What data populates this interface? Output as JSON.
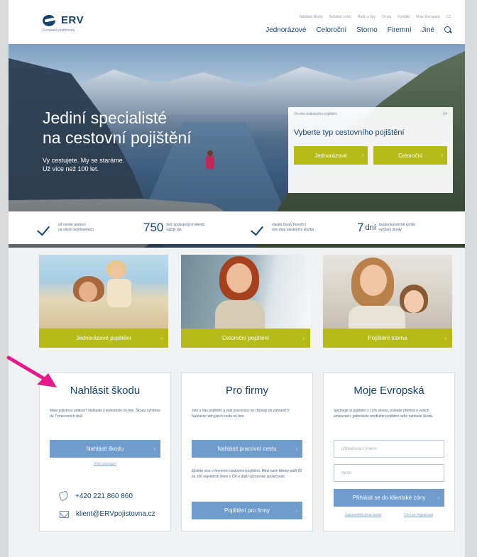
{
  "header": {
    "logo_text": "ERV",
    "logo_sub": "Evropská pojišťovna",
    "top_links": [
      "Nahlásit škodu",
      "Nahlásit cestu",
      "Rady a tipy",
      "O nás",
      "Kontakt",
      "Moje Evropská",
      "CZ"
    ],
    "nav": [
      "Jednorázové",
      "Celoroční",
      "Storno",
      "Firemní",
      "Jiné"
    ]
  },
  "hero": {
    "title_line1": "Jediní specialisté",
    "title_line2": "na cestovní pojištění",
    "sub_line1": "Vy cestujete. My se staráme.",
    "sub_line2": "Už více než 100 let.",
    "box": {
      "top_left": "On-line kalkulačka pojištění",
      "top_right": "1/4",
      "title": "Vyberte typ cestovního pojištění",
      "btn1": "Jednorázové",
      "btn2": "Celoroční"
    }
  },
  "stats": {
    "s1_line1": "síť center pomoci",
    "s1_line2": "na všech kontinentech",
    "s2_num": "750",
    "s2_line1": "tisíc spokojených klientů",
    "s2_line2": "každý rok",
    "s3_line1": "vlastní česky hovořící",
    "s3_line2": "non-stop asistenční služba",
    "s4_num": "7",
    "s4_unit": "dní",
    "s4_line1": "bezkonkurenčně rychlé",
    "s4_line2": "vyřízení škody"
  },
  "products": [
    "Jednorázové pojištění",
    "Celoroční pojištění",
    "Pojištění storna"
  ],
  "panels": {
    "claim": {
      "title": "Nahlásit škodu",
      "text": "Máte pojistnou událost? Nahlaste ji jednoduše on-line. Škodu vyřídíme do 7 pracovních dnů!",
      "button": "Nahlásit škodu",
      "link": "Více informací",
      "phone": "+420 221 860 860",
      "email": "klient@ERVpojistovna.cz"
    },
    "business": {
      "title": "Pro firmy",
      "text1": "Jste u nás pojištění a vaši pracovníci se chystají do zahraničí? Nahlaste nám jejich cestu on-line.",
      "button1": "Nahlásit pracovní cestu",
      "text2": "Zjistěte více o firemním cestovním pojištění. Mezi naše klienty patří 60 ze 100 největších firem v ČR a další významné společnosti.",
      "button2": "Pojištění pro firmy"
    },
    "account": {
      "title": "Moje Evropská",
      "text": "Sjednejte si pojištění s 10% slevou, získejte přehled o vašich smlouvách, jednoduše prodlužte pojištění nebo nahlaste škodu.",
      "login_placeholder": "přihlašovací jméno",
      "password_placeholder": "heslo",
      "button": "Přihlásit se do klientské zóny",
      "link1": "Zapomněl/a jsem heslo",
      "link2": "Chci se registrovat"
    }
  },
  "colors": {
    "brand_navy": "#17446e",
    "accent_olive": "#b5b919",
    "button_blue": "#6f9ccc",
    "arrow_magenta": "#e5198a"
  }
}
